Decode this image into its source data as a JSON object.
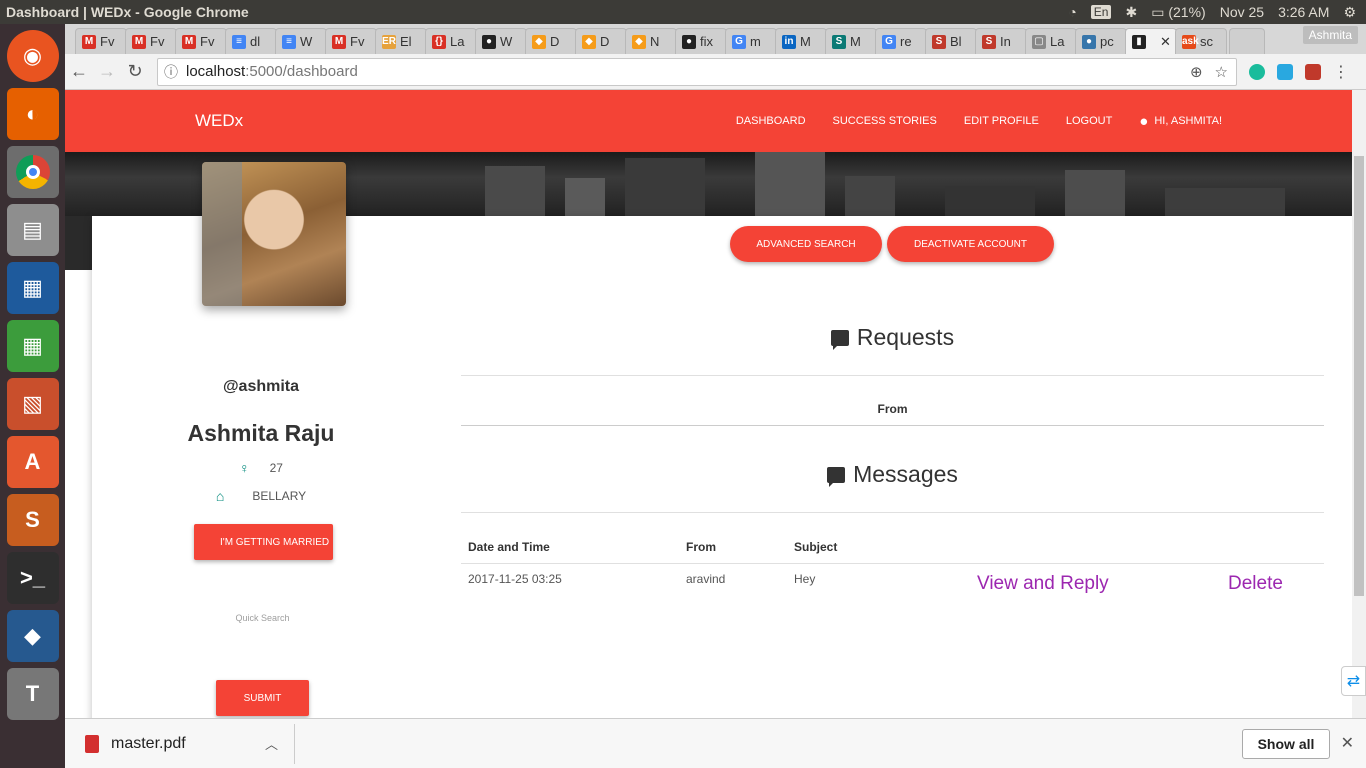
{
  "os": {
    "window_title": "Dashboard | WEDx - Google Chrome",
    "keyboard": "En",
    "battery": "(21%)",
    "date": "Nov 25",
    "time": "3:26 AM"
  },
  "chrome": {
    "tabs": [
      {
        "label": "Fv",
        "fav": "M",
        "color": "#d93025"
      },
      {
        "label": "Fv",
        "fav": "M",
        "color": "#d93025"
      },
      {
        "label": "Fv",
        "fav": "M",
        "color": "#d93025"
      },
      {
        "label": "dl",
        "fav": "≡",
        "color": "#4285f4"
      },
      {
        "label": "W",
        "fav": "≡",
        "color": "#4285f4"
      },
      {
        "label": "Fv",
        "fav": "M",
        "color": "#d93025"
      },
      {
        "label": "El",
        "fav": "ER",
        "color": "#e6a23c"
      },
      {
        "label": "La",
        "fav": "{}",
        "color": "#d93025"
      },
      {
        "label": "W",
        "fav": "●",
        "color": "#222222"
      },
      {
        "label": "D",
        "fav": "◆",
        "color": "#f59c1a"
      },
      {
        "label": "D",
        "fav": "◆",
        "color": "#f59c1a"
      },
      {
        "label": "N",
        "fav": "◆",
        "color": "#f59c1a"
      },
      {
        "label": "fix",
        "fav": "●",
        "color": "#222222"
      },
      {
        "label": "m",
        "fav": "G",
        "color": "#4285f4"
      },
      {
        "label": "M",
        "fav": "in",
        "color": "#0a66c2"
      },
      {
        "label": "M",
        "fav": "S",
        "color": "#0b7a75"
      },
      {
        "label": "re",
        "fav": "G",
        "color": "#4285f4"
      },
      {
        "label": "Bl",
        "fav": "S",
        "color": "#c0392b"
      },
      {
        "label": "In",
        "fav": "S",
        "color": "#c0392b"
      },
      {
        "label": "La",
        "fav": "▢",
        "color": "#888888"
      },
      {
        "label": "pc",
        "fav": "●",
        "color": "#3776ab"
      },
      {
        "label": "",
        "fav": "▮",
        "color": "#222222",
        "active": true
      },
      {
        "label": "sc",
        "fav": "ask",
        "color": "#e64a19"
      }
    ],
    "profile": "Ashmita",
    "url_host": "localhost",
    "url_rest": ":5000/dashboard"
  },
  "navbar": {
    "brand": "WEDx",
    "links": [
      "DASHBOARD",
      "SUCCESS STORIES",
      "EDIT PROFILE",
      "LOGOUT"
    ],
    "greeting": "HI, ASHMITA!"
  },
  "profile": {
    "username": "@ashmita",
    "full_name": "Ashmita Raju",
    "age": "27",
    "city": "BELLARY",
    "married_label": "I'M GETTING MARRIED",
    "quick_search_label": "Quick Search",
    "submit_label": "SUBMIT"
  },
  "actions": {
    "advanced_search": "ADVANCED SEARCH",
    "deactivate": "DEACTIVATE ACCOUNT"
  },
  "requests": {
    "title": "Requests",
    "columns": [
      "From"
    ]
  },
  "messages": {
    "title": "Messages",
    "columns": [
      "Date and Time",
      "From",
      "Subject"
    ],
    "rows": [
      {
        "datetime": "2017-11-25 03:25",
        "from": "aravind",
        "subject": "Hey",
        "view": "View and Reply",
        "delete": "Delete"
      }
    ]
  },
  "downloads": {
    "file": "master.pdf",
    "show_all": "Show all"
  }
}
